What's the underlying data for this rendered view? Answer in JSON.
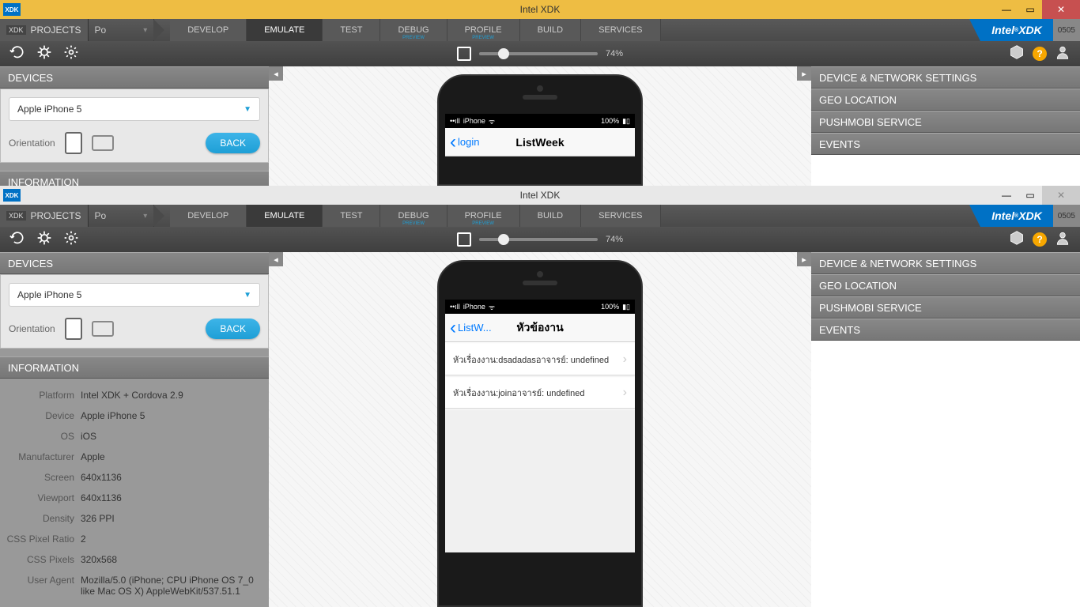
{
  "window": {
    "title": "Intel XDK",
    "icon_label": "XDK"
  },
  "brand": {
    "name": "Intel® XDK",
    "version": "0505"
  },
  "projects": {
    "label": "PROJECTS",
    "current": "Po"
  },
  "tabs": [
    "DEVELOP",
    "EMULATE",
    "TEST",
    "DEBUG",
    "PROFILE",
    "BUILD",
    "SERVICES"
  ],
  "tabs_active": "EMULATE",
  "preview_tabs": [
    "DEBUG",
    "PROFILE"
  ],
  "zoom": "74%",
  "devices_panel": {
    "title": "DEVICES",
    "selected": "Apple iPhone 5",
    "orientation_label": "Orientation",
    "back_label": "BACK"
  },
  "info_panel": {
    "title": "INFORMATION",
    "rows": [
      {
        "label": "Platform",
        "value": "Intel XDK + Cordova 2.9"
      },
      {
        "label": "Device",
        "value": "Apple iPhone 5"
      },
      {
        "label": "OS",
        "value": "iOS"
      },
      {
        "label": "Manufacturer",
        "value": "Apple"
      },
      {
        "label": "Screen",
        "value": "640x1136"
      },
      {
        "label": "Viewport",
        "value": "640x1136"
      },
      {
        "label": "Density",
        "value": "326 PPI"
      },
      {
        "label": "CSS Pixel Ratio",
        "value": "2"
      },
      {
        "label": "CSS Pixels",
        "value": "320x568"
      },
      {
        "label": "User Agent",
        "value": "Mozilla/5.0 (iPhone; CPU iPhone OS 7_0 like Mac OS X) AppleWebKit/537.51.1"
      }
    ]
  },
  "right_panels": [
    "DEVICE & NETWORK SETTINGS",
    "GEO LOCATION",
    "PUSHMOBI SERVICE",
    "EVENTS"
  ],
  "phone1": {
    "status_carrier": "iPhone",
    "status_battery": "100%",
    "back_link": "login",
    "title": "ListWeek"
  },
  "phone2": {
    "status_carrier": "iPhone",
    "status_battery": "100%",
    "back_link": "ListW...",
    "title": "หัวข้องาน",
    "items": [
      "หัวเรื่องงาน:dsadadasอาจารย์: undefined",
      "หัวเรื่องงาน:joinอาจารย์: undefined"
    ]
  }
}
